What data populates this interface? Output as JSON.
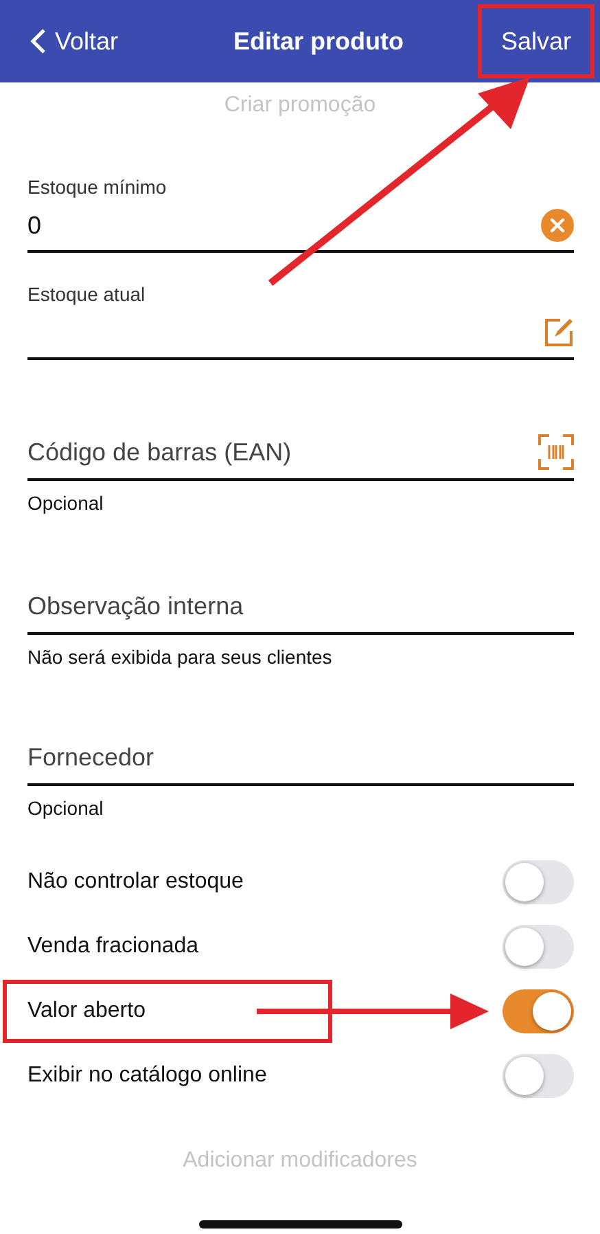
{
  "header": {
    "back": "Voltar",
    "title": "Editar produto",
    "save": "Salvar",
    "save_annotated": true
  },
  "promo_link": "Criar promoção",
  "fields": [
    {
      "kind": "clearable",
      "label": "Estoque mínimo",
      "value": "0"
    },
    {
      "kind": "editable",
      "label": "Estoque atual"
    },
    {
      "kind": "scannable",
      "placeholder": "Código de barras (EAN)",
      "hint": "Opcional"
    },
    {
      "kind": "plain",
      "placeholder": "Observação interna",
      "hint": "Não será exibida para seus clientes"
    },
    {
      "kind": "plain",
      "placeholder": "Fornecedor",
      "hint": "Opcional"
    }
  ],
  "toggles": [
    {
      "label": "Não controlar estoque",
      "on": false,
      "annotated": false
    },
    {
      "label": "Venda fracionada",
      "on": false,
      "annotated": false
    },
    {
      "label": "Valor aberto",
      "on": true,
      "annotated": true
    },
    {
      "label": "Exibir no catálogo online",
      "on": false,
      "annotated": false
    }
  ],
  "modifiers_link": "Adicionar modificadores"
}
